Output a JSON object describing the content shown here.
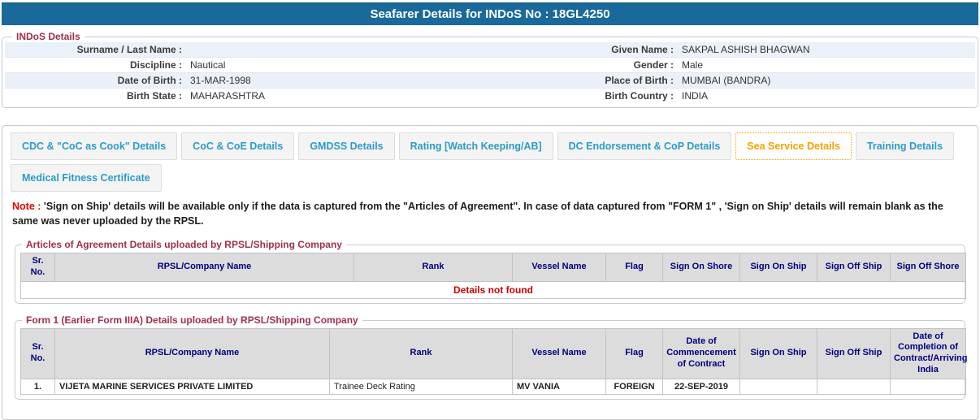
{
  "title": "Seafarer Details for INDoS No : 18GL4250",
  "colors": {
    "title_bar": "#19699b",
    "legend_maroon": "#a0304a",
    "tab_text_blue": "#2b9cc7",
    "active_tab_orange": "#f5a400",
    "table_header_navy": "#000080",
    "alert_red": "#cc0000"
  },
  "indos_details": {
    "legend": "INDoS Details",
    "rows": [
      {
        "label_left": "Surname / Last Name :",
        "value_left": "",
        "label_right": "Given Name :",
        "value_right": "SAKPAL ASHISH BHAGWAN"
      },
      {
        "label_left": "Discipline :",
        "value_left": "Nautical",
        "label_right": "Gender :",
        "value_right": "Male"
      },
      {
        "label_left": "Date of Birth :",
        "value_left": "31-MAR-1998",
        "label_right": "Place of Birth :",
        "value_right": "MUMBAI (BANDRA)"
      },
      {
        "label_left": "Birth State :",
        "value_left": "MAHARASHTRA",
        "label_right": "Birth Country :",
        "value_right": "INDIA"
      }
    ]
  },
  "tabs": {
    "active_label": "Sea Service Details",
    "items": [
      {
        "label": "CDC & \"CoC as Cook\" Details"
      },
      {
        "label": "CoC & CoE Details"
      },
      {
        "label": "GMDSS Details"
      },
      {
        "label": "Rating [Watch Keeping/AB]"
      },
      {
        "label": "DC Endorsement & CoP Details"
      },
      {
        "label": "Sea Service Details"
      },
      {
        "label": "Training Details"
      },
      {
        "label": "Medical Fitness Certificate"
      }
    ]
  },
  "note": {
    "label": "Note :",
    "text": " 'Sign on Ship' details will be available only if the data is captured from the \"Articles of Agreement\". In case of data captured from \"FORM 1\" , 'Sign on Ship' details will remain blank as the same was never uploaded by the RPSL."
  },
  "articles_table": {
    "legend": "Articles of Agreement Details uploaded by RPSL/Shipping Company",
    "headers": [
      "Sr. No.",
      "RPSL/Company Name",
      "Rank",
      "Vessel Name",
      "Flag",
      "Sign On Shore",
      "Sign On Ship",
      "Sign Off Ship",
      "Sign Off Shore"
    ],
    "empty_message": "Details not found"
  },
  "form1_table": {
    "legend": "Form 1 (Earlier Form IIIA) Details uploaded by RPSL/Shipping Company",
    "headers": [
      "Sr. No.",
      "RPSL/Company Name",
      "Rank",
      "Vessel Name",
      "Flag",
      "Date of Commencement of Contract",
      "Sign On Ship",
      "Sign Off Ship",
      "Date of Completion of Contract/Arriving India"
    ],
    "rows": [
      {
        "sr_no": "1.",
        "company": "VIJETA MARINE SERVICES PRIVATE LIMITED",
        "rank": "Trainee Deck Rating",
        "vessel": "MV VANIA",
        "flag": "FOREIGN",
        "date_commencement": "22-SEP-2019",
        "sign_on_ship": "",
        "sign_off_ship": "",
        "date_completion": ""
      }
    ]
  }
}
